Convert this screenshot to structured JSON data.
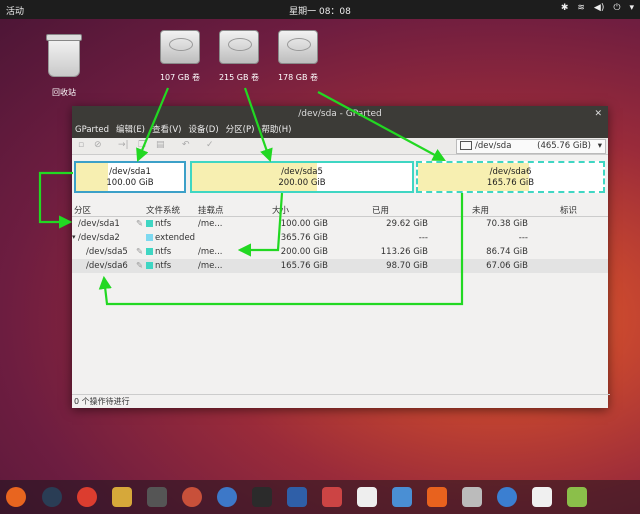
{
  "topbar": {
    "activities": "活动",
    "clock": "星期一 08：08",
    "tray": [
      "✱",
      "≋",
      "◀)",
      "⏻",
      "▾"
    ]
  },
  "desktop": {
    "trash_label": "回收站",
    "drives": [
      {
        "label": "107 GB 卷"
      },
      {
        "label": "215 GB 卷"
      },
      {
        "label": "178 GB 卷"
      }
    ]
  },
  "window": {
    "title": "/dev/sda - GParted",
    "close": "✕",
    "menu": [
      "GParted",
      "编辑(E)",
      "查看(V)",
      "设备(D)",
      "分区(P)",
      "帮助(H)"
    ],
    "toolbar": {
      "device": "/dev/sda",
      "device_size": "(465.76 GiB)"
    },
    "map": [
      {
        "name": "/dev/sda1",
        "size": "100.00 GiB"
      },
      {
        "name": "/dev/sda5",
        "size": "200.00 GiB"
      },
      {
        "name": "/dev/sda6",
        "size": "165.76 GiB"
      }
    ],
    "columns": {
      "partition": "分区",
      "filesystem": "文件系统",
      "mount": "挂载点",
      "size": "大小",
      "used": "已用",
      "unused": "未用",
      "flags": "标识"
    },
    "rows": [
      {
        "partition": "/dev/sda1",
        "filesystem": "ntfs",
        "mount": "/me...",
        "size": "100.00 GiB",
        "used": "29.62 GiB",
        "unused": "70.38 GiB"
      },
      {
        "partition": "/dev/sda2",
        "filesystem": "extended",
        "mount": "",
        "size": "365.76 GiB",
        "used": "---",
        "unused": "---"
      },
      {
        "partition": "/dev/sda5",
        "filesystem": "ntfs",
        "mount": "/me...",
        "size": "200.00 GiB",
        "used": "113.26 GiB",
        "unused": "86.74 GiB"
      },
      {
        "partition": "/dev/sda6",
        "filesystem": "ntfs",
        "mount": "/me...",
        "size": "165.76 GiB",
        "used": "98.70 GiB",
        "unused": "67.06 GiB"
      }
    ],
    "status": "0 个操作待进行"
  },
  "colors": {
    "ntfs": "#3fd6c3",
    "extended": "#7ed9f0",
    "annotation": "#22d822"
  },
  "dock": [
    "firefox",
    "camera",
    "chrome",
    "editor",
    "settings",
    "gear",
    "appgrid",
    "terminal",
    "photos",
    "archive",
    "media",
    "document",
    "software",
    "camera2",
    "help",
    "amazon",
    "scan"
  ]
}
